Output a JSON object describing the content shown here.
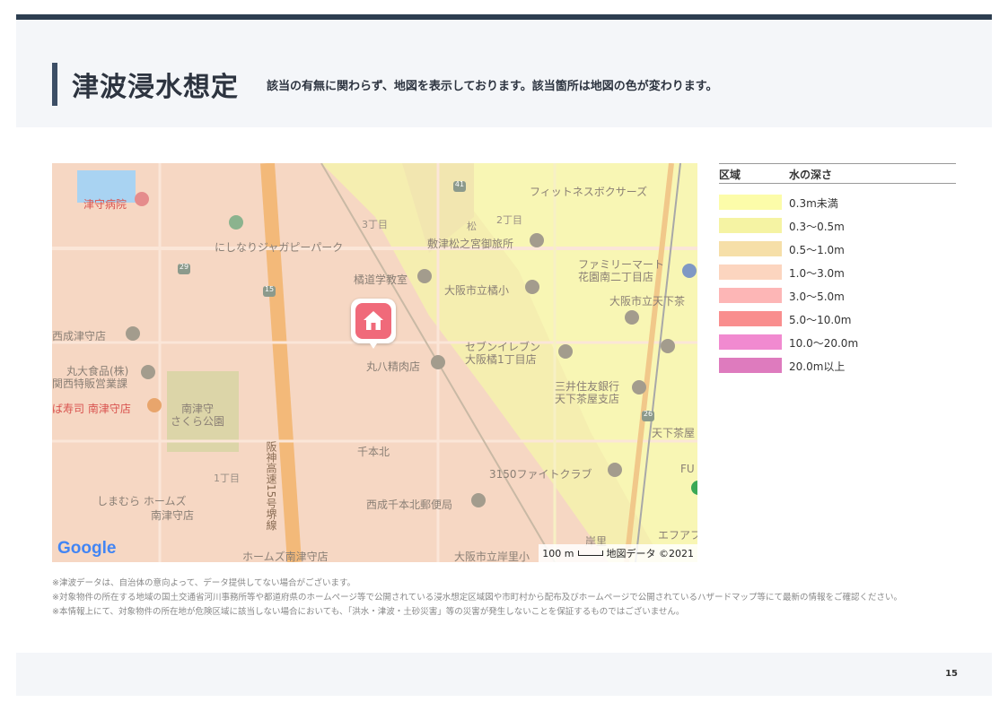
{
  "header": {
    "title": "津波浸水想定",
    "subtitle": "該当の有無に関わらず、地図を表示しております。該当箇所は地図の色が変わります。"
  },
  "map": {
    "labels": [
      {
        "text": "津守病院",
        "style": "red"
      },
      {
        "text": "にしなりジャガピーパーク",
        "style": ""
      },
      {
        "text": "橘道学教室",
        "style": ""
      },
      {
        "text": "敷津松之宮御旅所",
        "style": ""
      },
      {
        "text": "フィットネスボクサーズ",
        "style": ""
      },
      {
        "text": "ファミリーマート",
        "style": ""
      },
      {
        "text": "花園南二丁目店",
        "style": ""
      },
      {
        "text": "大阪市立橘小",
        "style": ""
      },
      {
        "text": "大阪市立天下茶",
        "style": ""
      },
      {
        "text": "西成津守店",
        "style": ""
      },
      {
        "text": "丸大食品(株)",
        "style": ""
      },
      {
        "text": "関西特販営業課",
        "style": ""
      },
      {
        "text": "ば寿司 南津守店",
        "style": "red"
      },
      {
        "text": "南津守",
        "style": ""
      },
      {
        "text": "さくら公園",
        "style": ""
      },
      {
        "text": "丸八精肉店",
        "style": ""
      },
      {
        "text": "セブンイレブン",
        "style": ""
      },
      {
        "text": "大阪橘1丁目店",
        "style": ""
      },
      {
        "text": "三井住友銀行",
        "style": ""
      },
      {
        "text": "天下茶屋支店",
        "style": ""
      },
      {
        "text": "天下茶屋",
        "style": ""
      },
      {
        "text": "千本北",
        "style": ""
      },
      {
        "text": "3150ファイトクラブ",
        "style": ""
      },
      {
        "text": "しまむら ホームズ",
        "style": ""
      },
      {
        "text": "南津守店",
        "style": ""
      },
      {
        "text": "西成千本北郵便局",
        "style": ""
      },
      {
        "text": "阪神高速15号堺線",
        "style": ""
      },
      {
        "text": "ホームズ南津守店",
        "style": ""
      },
      {
        "text": "大阪市立岸里小",
        "style": ""
      },
      {
        "text": "エフアフ",
        "style": ""
      },
      {
        "text": "岸里",
        "style": ""
      },
      {
        "text": "3丁目",
        "style": "small"
      },
      {
        "text": "2丁目",
        "style": "small"
      },
      {
        "text": "1丁目",
        "style": "small"
      },
      {
        "text": "松",
        "style": "small"
      },
      {
        "text": "FU",
        "style": ""
      }
    ],
    "route_badges": [
      "41",
      "29",
      "15",
      "26"
    ],
    "google_logo": "Google",
    "scale": "100 m",
    "attribution": "地図データ ©2021"
  },
  "legend": {
    "col_area": "区域",
    "col_depth": "水の深さ",
    "items": [
      {
        "label": "0.3m未満",
        "color": "#fcfca9"
      },
      {
        "label": "0.3〜0.5m",
        "color": "#f5f3a3"
      },
      {
        "label": "0.5〜1.0m",
        "color": "#f6dfa8"
      },
      {
        "label": "1.0〜3.0m",
        "color": "#fcd5bf"
      },
      {
        "label": "3.0〜5.0m",
        "color": "#fdb6b6"
      },
      {
        "label": "5.0〜10.0m",
        "color": "#f98e8e"
      },
      {
        "label": "10.0〜20.0m",
        "color": "#f18ad0"
      },
      {
        "label": "20.0m以上",
        "color": "#de7bbe"
      }
    ]
  },
  "notes": [
    "※津波データは、自治体の意向よって、データ提供してない場合がございます。",
    "※対象物件の所在する地域の国土交通省河川事務所等や都道府県のホームページ等で公開されている浸水想定区域図や市町村から配布及びホームページで公開されているハザードマップ等にて最新の情報をご確認ください。",
    "※本情報上にて、対象物件の所在地が危険区域に該当しない場合においても、「洪水・津波・土砂災害」等の災害が発生しないことを保証するものではございません。"
  ],
  "footer": {
    "page_number": "15"
  }
}
